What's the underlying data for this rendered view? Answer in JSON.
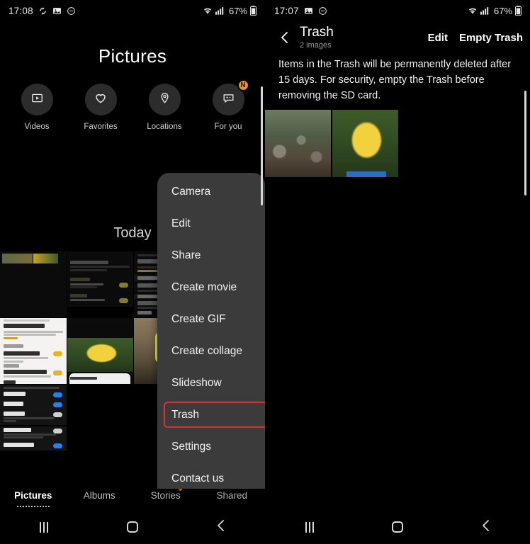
{
  "left": {
    "status_bar": {
      "time": "17:08",
      "icons": [
        "sync-icon",
        "image-icon",
        "do-not-disturb-icon"
      ],
      "wifi": "wifi-icon",
      "signal": "cellular-signal-icon",
      "battery_percent": "67%",
      "battery": "battery-icon"
    },
    "page_title": "Pictures",
    "shortcuts": [
      {
        "label": "Videos",
        "icon": "video-play-icon",
        "badge": null
      },
      {
        "label": "Favorites",
        "icon": "heart-icon",
        "badge": null
      },
      {
        "label": "Locations",
        "icon": "map-pin-icon",
        "badge": null
      },
      {
        "label": "For you",
        "icon": "sparkle-chat-icon",
        "badge": "N"
      }
    ],
    "section_label": "Today",
    "menu": {
      "items": [
        {
          "label": "Camera",
          "highlighted": false
        },
        {
          "label": "Edit",
          "highlighted": false
        },
        {
          "label": "Share",
          "highlighted": false
        },
        {
          "label": "Create movie",
          "highlighted": false
        },
        {
          "label": "Create GIF",
          "highlighted": false
        },
        {
          "label": "Create collage",
          "highlighted": false
        },
        {
          "label": "Slideshow",
          "highlighted": false
        },
        {
          "label": "Trash",
          "highlighted": true
        },
        {
          "label": "Settings",
          "highlighted": false
        },
        {
          "label": "Contact us",
          "highlighted": false
        }
      ],
      "highlight_color": "#e03030"
    },
    "tabs": [
      {
        "label": "Pictures",
        "active": true,
        "dot": false
      },
      {
        "label": "Albums",
        "active": false,
        "dot": false
      },
      {
        "label": "Stories",
        "active": false,
        "dot": true
      },
      {
        "label": "Shared",
        "active": false,
        "dot": false
      }
    ],
    "nav_bar": [
      "recents-icon",
      "home-icon",
      "back-icon"
    ]
  },
  "right": {
    "status_bar": {
      "time": "17:07",
      "icons": [
        "image-icon",
        "do-not-disturb-icon"
      ],
      "wifi": "wifi-icon",
      "signal": "cellular-signal-icon",
      "battery_percent": "67%",
      "battery": "battery-icon"
    },
    "header": {
      "back": "back-chevron-icon",
      "title": "Trash",
      "subtitle": "2 images",
      "actions": [
        {
          "label": "Edit"
        },
        {
          "label": "Empty Trash"
        }
      ]
    },
    "description": "Items in the Trash will be permanently deleted after 15 days. For security, empty the Trash before removing the SD card.",
    "thumbnails": [
      {
        "name": "trees-photo"
      },
      {
        "name": "yellow-duck-photo"
      }
    ],
    "nav_bar": [
      "recents-icon",
      "home-icon",
      "back-icon"
    ]
  },
  "colors": {
    "background": "#000000",
    "menu_background": "#3b3b3b",
    "accent_orange": "#eb9019",
    "highlight_red": "#e03030",
    "text_primary": "#ffffff",
    "text_secondary": "#9a9a9a"
  }
}
